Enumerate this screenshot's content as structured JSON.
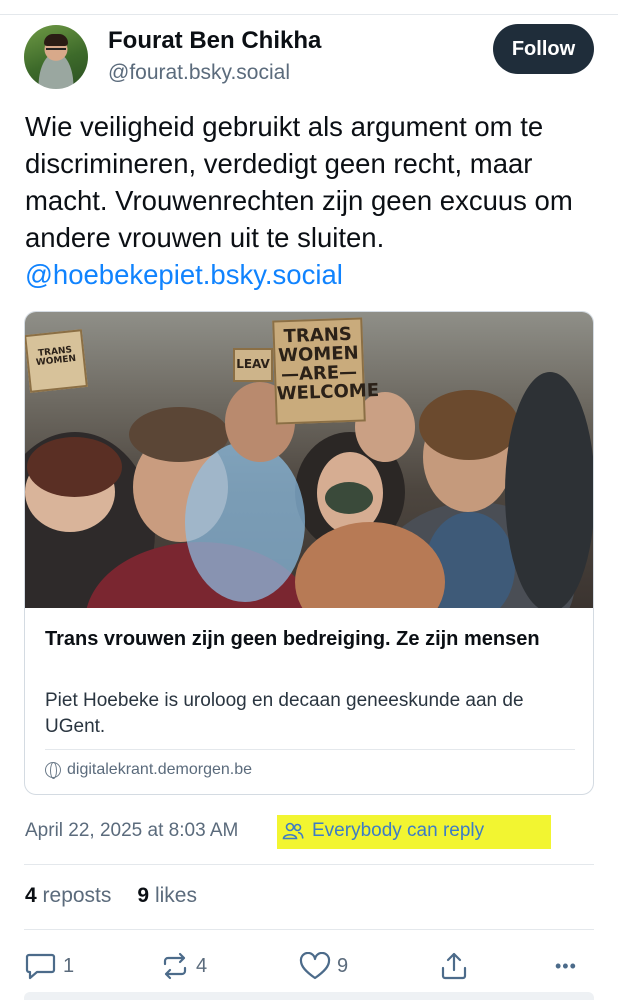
{
  "author": {
    "name": "Fourat Ben Chikha",
    "handle": "@fourat.bsky.social",
    "follow_label": "Follow"
  },
  "post": {
    "text": "Wie veiligheid gebruikt als argument om te discrimineren, verdedigt geen recht, maar macht. Vrouwenrechten zijn geen excuus om andere vrouwen uit te sluiten.",
    "mention": "@hoebekepiet.bsky.social"
  },
  "link_card": {
    "title": "Trans vrouwen zijn geen bedreiging. Ze zijn mensen",
    "description": "Piet Hoebeke is uroloog en decaan geneeskunde aan de UGent.",
    "domain": "digitalekrant.demorgen.be",
    "photo": {
      "sign_main": "TRANS WOMEN —ARE— WELCOME",
      "sign_left": "TRANS WOMEN",
      "sign_partial": "LEAV"
    }
  },
  "meta": {
    "timestamp": "April 22, 2025 at 8:03 AM",
    "reply_setting": "Everybody can reply",
    "highlight_color": "#f2f531"
  },
  "stats": {
    "reposts_count": "4",
    "reposts_label": "reposts",
    "likes_count": "9",
    "likes_label": "likes"
  },
  "actions": {
    "reply_count": "1",
    "repost_count": "4",
    "like_count": "9",
    "more": "•••"
  },
  "colors": {
    "accent": "#1083fe",
    "button_bg": "#1f2d3a",
    "muted": "#5b6b7c"
  }
}
